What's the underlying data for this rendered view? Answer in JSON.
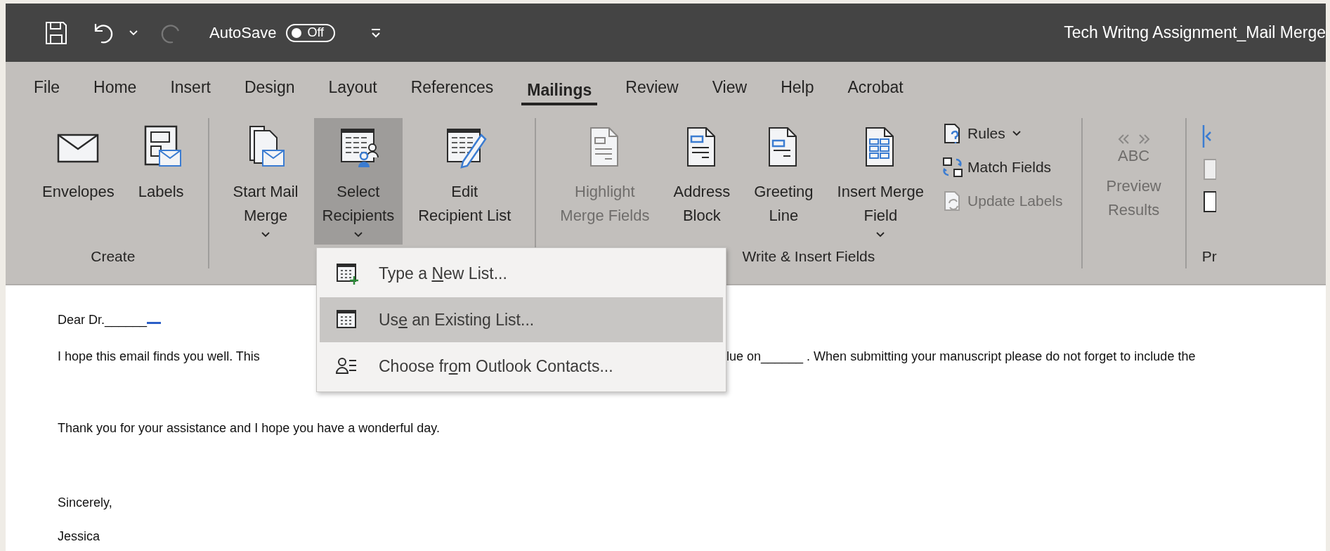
{
  "title_bar": {
    "autosave_label": "AutoSave",
    "autosave_toggle": {
      "text": "Off",
      "on": false
    },
    "redo_disabled": true,
    "title": "Tech Writng Assignment_Mail Merge"
  },
  "tabs": [
    {
      "label": "File",
      "selected": false
    },
    {
      "label": "Home",
      "selected": false
    },
    {
      "label": "Insert",
      "selected": false
    },
    {
      "label": "Design",
      "selected": false
    },
    {
      "label": "Layout",
      "selected": false
    },
    {
      "label": "References",
      "selected": false
    },
    {
      "label": "Mailings",
      "selected": true
    },
    {
      "label": "Review",
      "selected": false
    },
    {
      "label": "View",
      "selected": false
    },
    {
      "label": "Help",
      "selected": false
    },
    {
      "label": "Acrobat",
      "selected": false
    }
  ],
  "ribbon": {
    "groups": [
      {
        "label": "Create",
        "items": [
          {
            "kind": "large",
            "lines": [
              "Envelopes"
            ],
            "dropdown": false,
            "disabled": false
          },
          {
            "kind": "large",
            "lines": [
              "Labels"
            ],
            "dropdown": false,
            "disabled": false
          }
        ]
      },
      {
        "items": [
          {
            "kind": "large",
            "lines": [
              "Start Mail",
              "Merge"
            ],
            "dropdown": true,
            "disabled": false
          },
          {
            "kind": "large",
            "lines": [
              "Select",
              "Recipients"
            ],
            "dropdown": true,
            "disabled": false,
            "expanded": true
          },
          {
            "kind": "large",
            "lines": [
              "Edit",
              "Recipient List"
            ],
            "dropdown": false,
            "disabled": false
          }
        ]
      },
      {
        "label": "Write & Insert Fields",
        "items": [
          {
            "kind": "large",
            "lines": [
              "Highlight",
              "Merge Fields"
            ],
            "dropdown": false,
            "disabled": true
          },
          {
            "kind": "large",
            "lines": [
              "Address",
              "Block"
            ],
            "dropdown": false,
            "disabled": false
          },
          {
            "kind": "large",
            "lines": [
              "Greeting",
              "Line"
            ],
            "dropdown": false,
            "disabled": false
          },
          {
            "kind": "large",
            "lines": [
              "Insert Merge",
              "Field"
            ],
            "dropdown": true,
            "disabled": false
          },
          {
            "kind": "small",
            "label": "Rules",
            "dropdown": true,
            "disabled": false
          },
          {
            "kind": "small",
            "label": "Match Fields",
            "dropdown": false,
            "disabled": false
          },
          {
            "kind": "small",
            "label": "Update Labels",
            "dropdown": false,
            "disabled": true
          }
        ]
      },
      {
        "items": [
          {
            "kind": "large",
            "icon_text": "ABC",
            "lines": [
              "Preview",
              "Results"
            ],
            "dropdown": false,
            "disabled": true
          }
        ]
      },
      {
        "label": "Pr",
        "items": [
          {
            "kind": "icons"
          }
        ]
      }
    ]
  },
  "menu": [
    {
      "parts": [
        "Type a ",
        "N",
        "ew List..."
      ],
      "selected": false
    },
    {
      "parts": [
        "Us",
        "e",
        " an Existing List..."
      ],
      "selected": true
    },
    {
      "parts": [
        "Choose fr",
        "o",
        "m Outlook Contacts..."
      ],
      "selected": false
    }
  ],
  "document": {
    "paragraphs": [
      {
        "kind": "field",
        "parts": [
          "Dear Dr.______"
        ]
      },
      {
        "kind": "split",
        "parts": [
          "I hope this email finds you well. This",
          "lue on______ . When submitting your manuscript please do not forget to include the"
        ]
      },
      {
        "kind": "plain",
        "parts": [
          "Thank you for your assistance and I hope you have a wonderful day."
        ]
      },
      {
        "kind": "plain",
        "parts": [
          "Sincerely,"
        ]
      },
      {
        "kind": "plain",
        "parts": [
          "Jessica"
        ]
      }
    ]
  }
}
